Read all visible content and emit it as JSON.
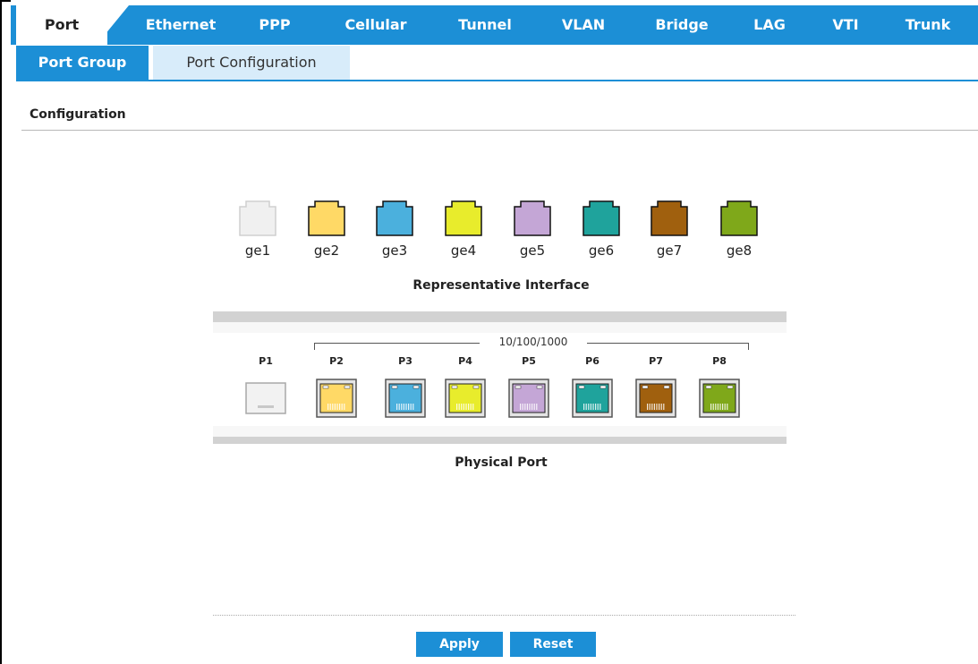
{
  "tabs": [
    {
      "label": "Port"
    },
    {
      "label": "Ethernet"
    },
    {
      "label": "PPP"
    },
    {
      "label": "Cellular"
    },
    {
      "label": "Tunnel"
    },
    {
      "label": "VLAN"
    },
    {
      "label": "Bridge"
    },
    {
      "label": "LAG"
    },
    {
      "label": "VTI"
    },
    {
      "label": "Trunk"
    }
  ],
  "subtabs": [
    {
      "label": "Port Group"
    },
    {
      "label": "Port Configuration"
    }
  ],
  "section": {
    "title": "Configuration"
  },
  "representative": {
    "title": "Representative Interface",
    "interfaces": [
      {
        "label": "ge1",
        "color": "#f0f0f0"
      },
      {
        "label": "ge2",
        "color": "#ffd966"
      },
      {
        "label": "ge3",
        "color": "#4bb0dd"
      },
      {
        "label": "ge4",
        "color": "#e8ec2c"
      },
      {
        "label": "ge5",
        "color": "#c4a6d6"
      },
      {
        "label": "ge6",
        "color": "#1fa39c"
      },
      {
        "label": "ge7",
        "color": "#a0600e"
      },
      {
        "label": "ge8",
        "color": "#7fa81a"
      }
    ]
  },
  "physical": {
    "title": "Physical Port",
    "speed_label": "10/100/1000",
    "ports": [
      {
        "label": "P1",
        "color": "#e6e6e6"
      },
      {
        "label": "P2",
        "color": "#ffd966"
      },
      {
        "label": "P3",
        "color": "#4bb0dd"
      },
      {
        "label": "P4",
        "color": "#e8ec2c"
      },
      {
        "label": "P5",
        "color": "#c4a6d6"
      },
      {
        "label": "P6",
        "color": "#1fa39c"
      },
      {
        "label": "P7",
        "color": "#a0600e"
      },
      {
        "label": "P8",
        "color": "#7fa81a"
      }
    ]
  },
  "buttons": {
    "apply": "Apply",
    "reset": "Reset"
  },
  "colors": {
    "accent": "#1c8fd6",
    "subtab_inactive": "#d8ecfa"
  }
}
